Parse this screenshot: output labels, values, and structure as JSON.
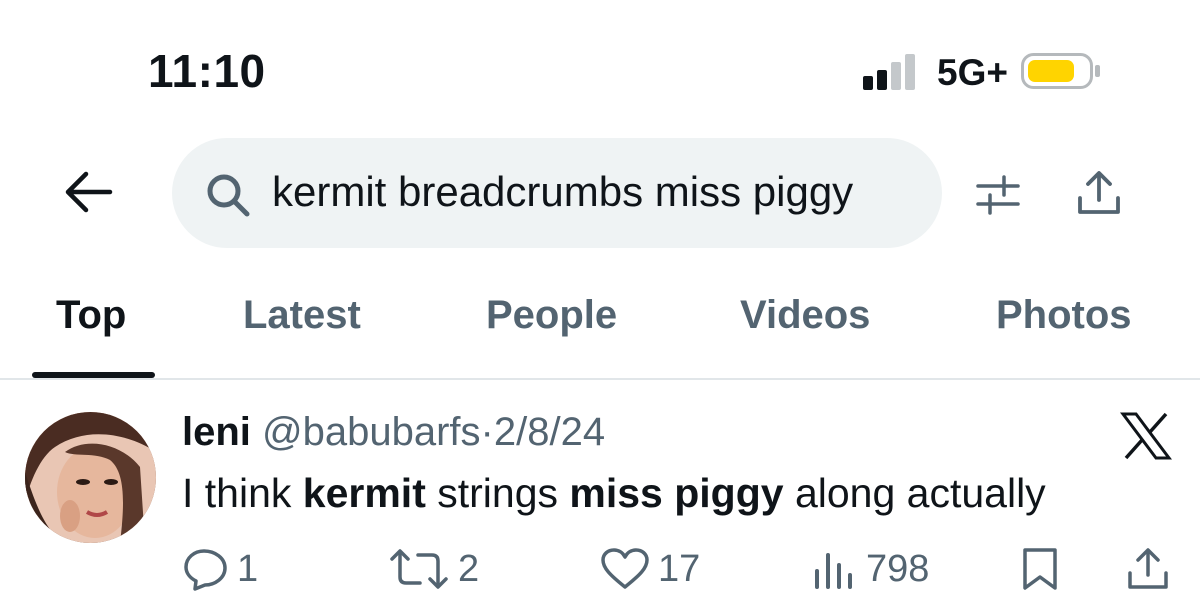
{
  "status_bar": {
    "time": "11:10",
    "network": "5G+",
    "battery_color": "#ffd400"
  },
  "search": {
    "query": "kermit breadcrumbs miss piggy",
    "icons": [
      "back-arrow-icon",
      "search-icon",
      "filter-icon",
      "share-icon"
    ]
  },
  "tabs": [
    {
      "label": "Top",
      "active": true
    },
    {
      "label": "Latest",
      "active": false
    },
    {
      "label": "People",
      "active": false
    },
    {
      "label": "Videos",
      "active": false
    },
    {
      "label": "Photos",
      "active": false
    }
  ],
  "tweet": {
    "name": "leni",
    "handle": "@babubarfs",
    "separator": "·",
    "date": "2/8/24",
    "text_parts": [
      {
        "text": "I think ",
        "bold": false
      },
      {
        "text": "kermit",
        "bold": true
      },
      {
        "text": " strings ",
        "bold": false
      },
      {
        "text": "miss piggy",
        "bold": true
      },
      {
        "text": " along actually",
        "bold": false
      }
    ],
    "replies": "1",
    "reposts": "2",
    "likes": "17",
    "views": "798"
  },
  "colors": {
    "text_primary": "#0f1419",
    "text_secondary": "#536471",
    "search_bg": "#eff3f4"
  }
}
